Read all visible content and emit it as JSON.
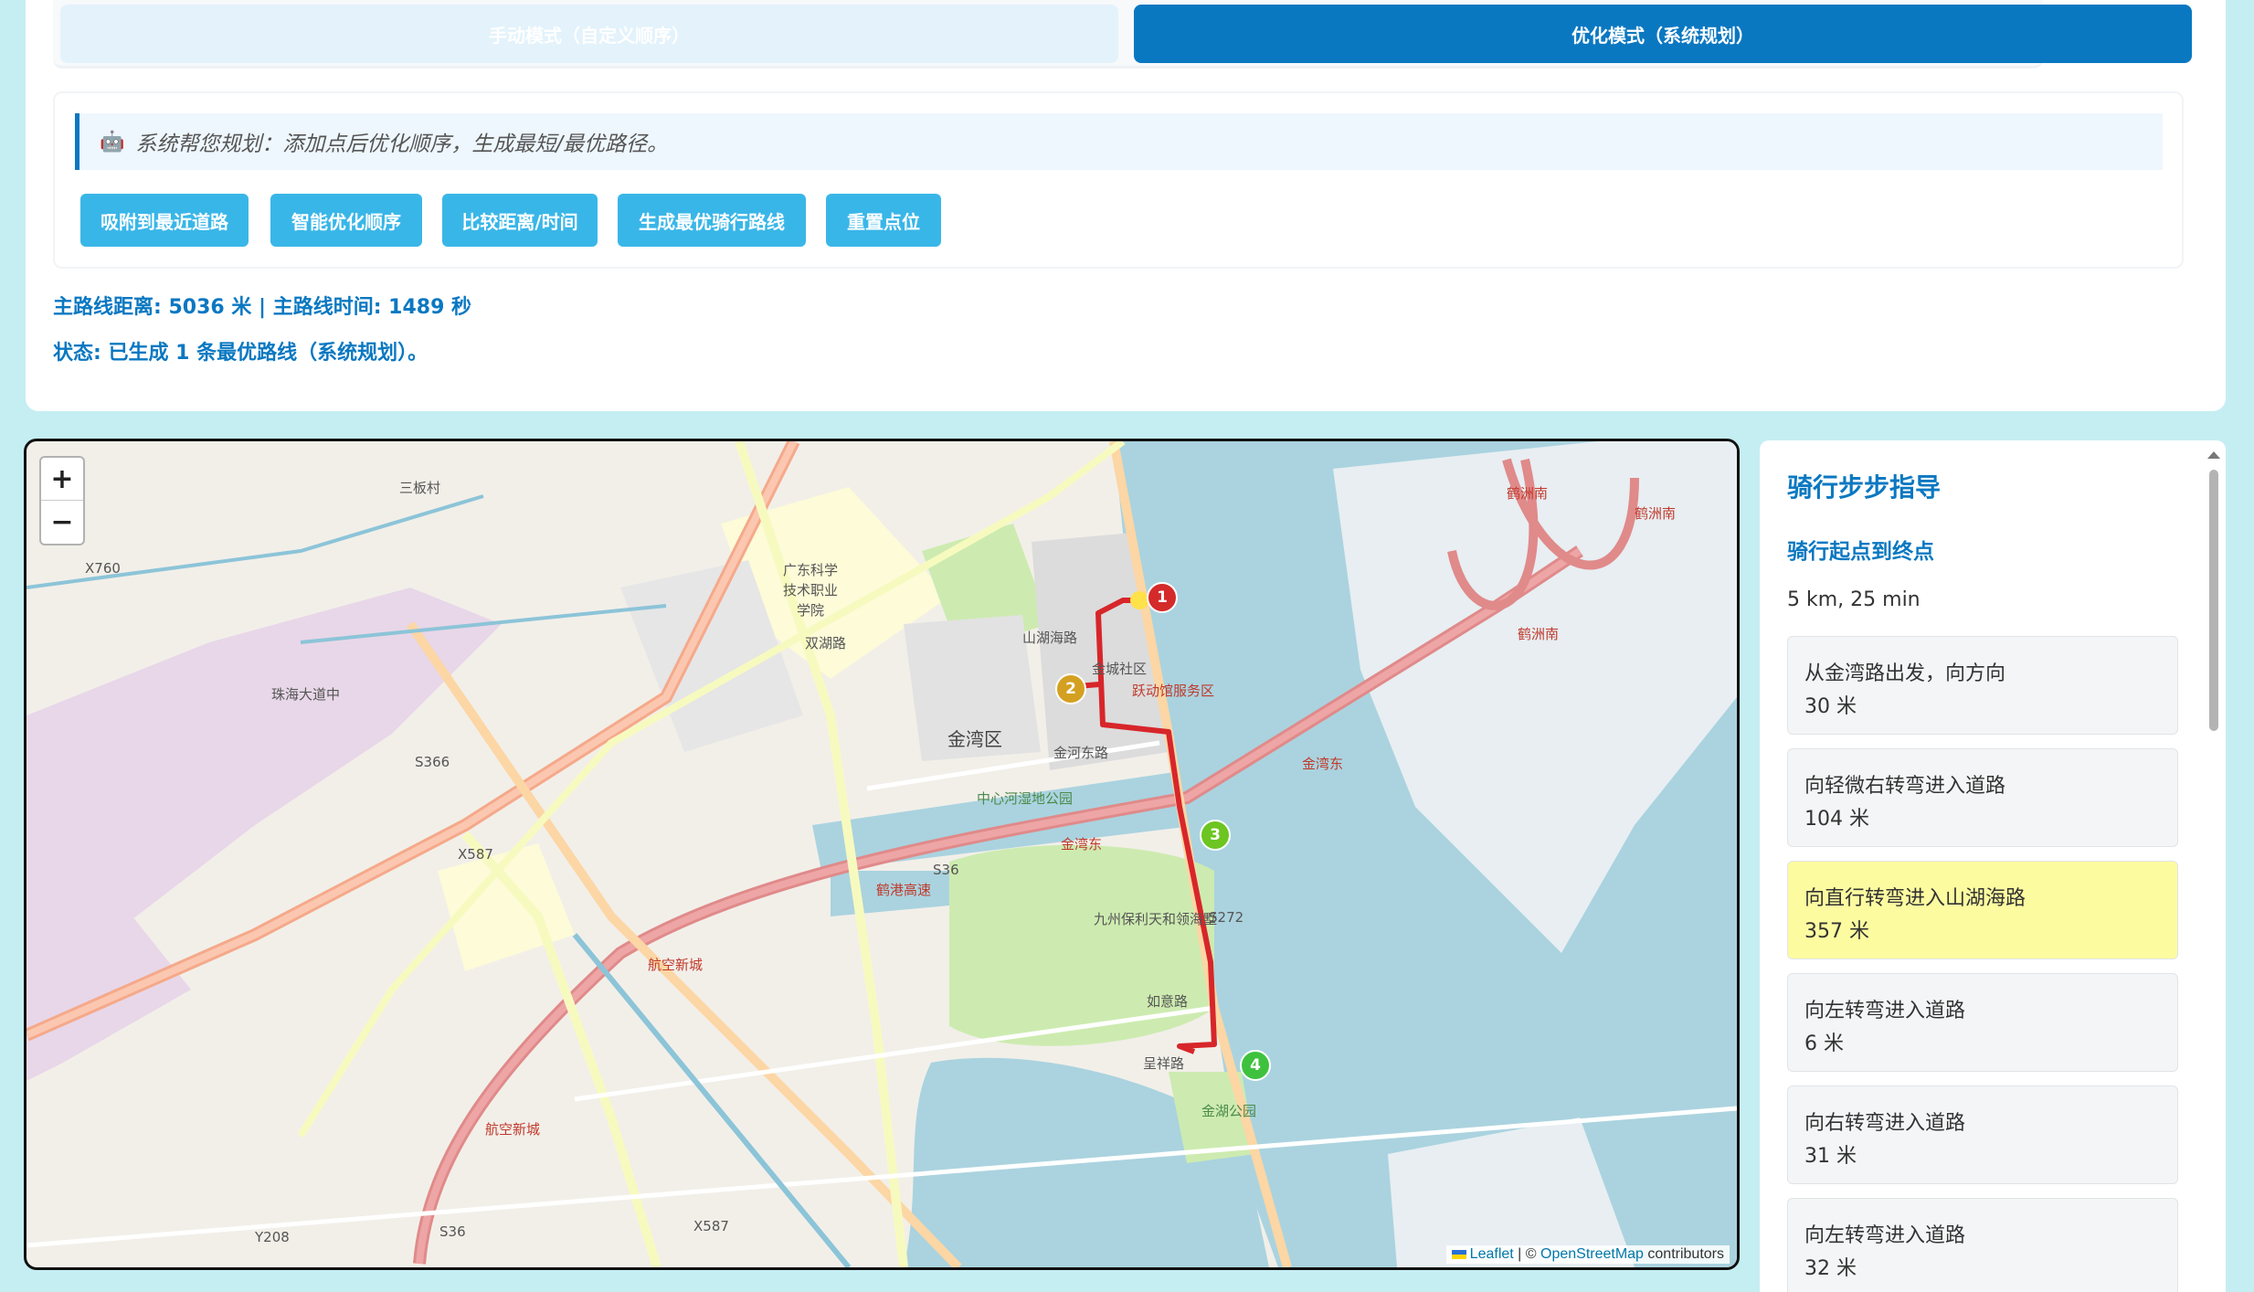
{
  "modes": {
    "manual_label": "手动模式（自定义顺序）",
    "optimized_label": "优化模式（系统规划）"
  },
  "hint": {
    "icon": "robot-icon",
    "text": "系统帮您规划：添加点后优化顺序，生成最短/最优路径。"
  },
  "actions": {
    "snap": "吸附到最近道路",
    "optimize": "智能优化顺序",
    "compare": "比较距离/时间",
    "generate": "生成最优骑行路线",
    "reset": "重置点位"
  },
  "stats": {
    "summary": "主路线距离: 5036 米 | 主路线时间: 1489 秒",
    "status": "状态: 已生成 1 条最优路线（系统规划）。"
  },
  "map": {
    "zoom_in": "+",
    "zoom_out": "−",
    "attribution": {
      "leaflet": "Leaflet",
      "sep": " | © ",
      "osm": "OpenStreetMap",
      "suffix": " contributors"
    },
    "markers": [
      "1",
      "2",
      "3",
      "4"
    ],
    "labels": {
      "district": "金湾区",
      "college": "广东科学技术职业学院",
      "sanbancun": "三板村",
      "x760": "X760",
      "s366": "S366",
      "x587a": "X587",
      "x587b": "X587",
      "s36a": "S36",
      "s36b": "S36",
      "s272": "S272",
      "zhuhai_ave": "珠海大道中",
      "hangkong": "航空新城",
      "hangkong2": "航空新城",
      "yuedong": "跃动馆服务区",
      "jinhu_park": "金湖公园",
      "center_park": "中心河湿地公园",
      "jiuzhou": "九州保利天和领海墅",
      "jinwan_east": "金湾东",
      "jinwan_east2": "金湾东",
      "shanhuhai": "山湖海路",
      "jincheng": "金城社区",
      "hezhou_s1": "鹤洲南",
      "hezhou_s2": "鹤洲南",
      "hezhou_n": "鹤洲南",
      "jinhe": "金河东路",
      "shuanglu": "双湖路",
      "chengxiang": "呈祥路",
      "rudao": "如意路",
      "hegang": "鹤港高速",
      "y208": "Y208"
    }
  },
  "guide": {
    "title": "骑行步步指导",
    "subtitle": "骑行起点到终点",
    "summary": "5 km, 25 min",
    "steps": [
      {
        "text": "从金湾路出发，向方向",
        "dist": "30 米"
      },
      {
        "text": "向轻微右转弯进入道路",
        "dist": "104 米"
      },
      {
        "text": "向直行转弯进入山湖海路",
        "dist": "357 米"
      },
      {
        "text": "向左转弯进入道路",
        "dist": "6 米"
      },
      {
        "text": "向右转弯进入道路",
        "dist": "31 米"
      },
      {
        "text": "向左转弯进入道路",
        "dist": "32 米"
      }
    ]
  },
  "colors": {
    "accent": "#0a78c1",
    "button": "#39b6e8",
    "route": "#d7262a",
    "highlight": "#fdfba0",
    "marker1": "#d42a2a",
    "marker2": "#d4a021",
    "marker3": "#6cc520",
    "marker4": "#3ec23e"
  }
}
